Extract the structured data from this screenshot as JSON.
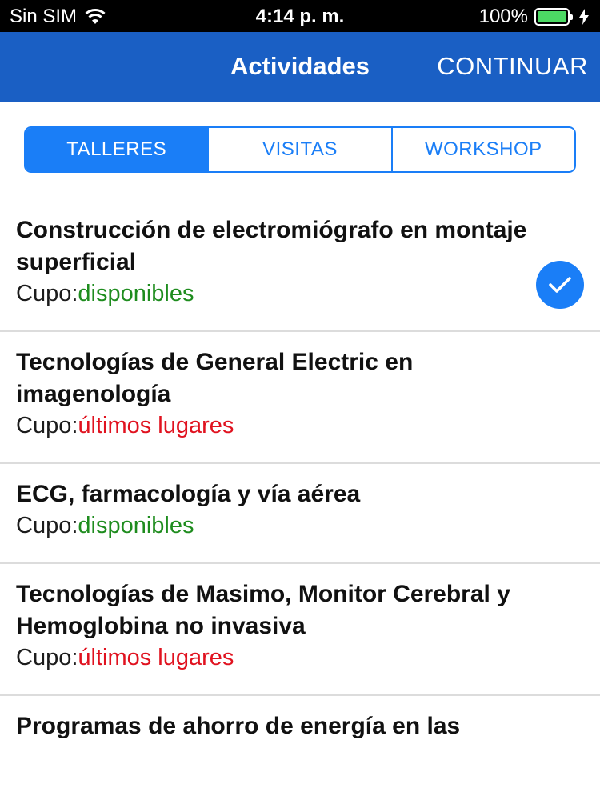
{
  "status_bar": {
    "carrier": "Sin SIM",
    "time": "4:14 p. m.",
    "battery_percent": "100%",
    "icons": [
      "wifi-icon",
      "battery-icon",
      "charging-icon"
    ]
  },
  "nav": {
    "title": "Actividades",
    "action_label": "CONTINUAR"
  },
  "tabs": [
    {
      "label": "TALLERES",
      "active": true
    },
    {
      "label": "VISITAS",
      "active": false
    },
    {
      "label": "WORKSHOP",
      "active": false
    }
  ],
  "list": {
    "cupo_prefix": "Cupo:",
    "items": [
      {
        "title": "Construcción de electromiógrafo en montaje superficial",
        "status": "disponibles",
        "status_color": "#1e8c1e",
        "selected": true
      },
      {
        "title": "Tecnologías de General Electric en imagenología",
        "status": "últimos lugares",
        "status_color": "#e0121f",
        "selected": false
      },
      {
        "title": "ECG, farmacología y vía aérea",
        "status": "disponibles",
        "status_color": "#1e8c1e",
        "selected": false
      },
      {
        "title": "Tecnologías de Masimo, Monitor Cerebral y Hemoglobina no invasiva",
        "status": "últimos lugares",
        "status_color": "#e0121f",
        "selected": false
      },
      {
        "title": "Programas de ahorro de energía en las",
        "status": "",
        "status_color": "",
        "selected": false
      }
    ]
  },
  "colors": {
    "nav_background": "#1a5fc4",
    "accent": "#1a7ef7",
    "available": "#1e8c1e",
    "limited": "#e0121f"
  }
}
